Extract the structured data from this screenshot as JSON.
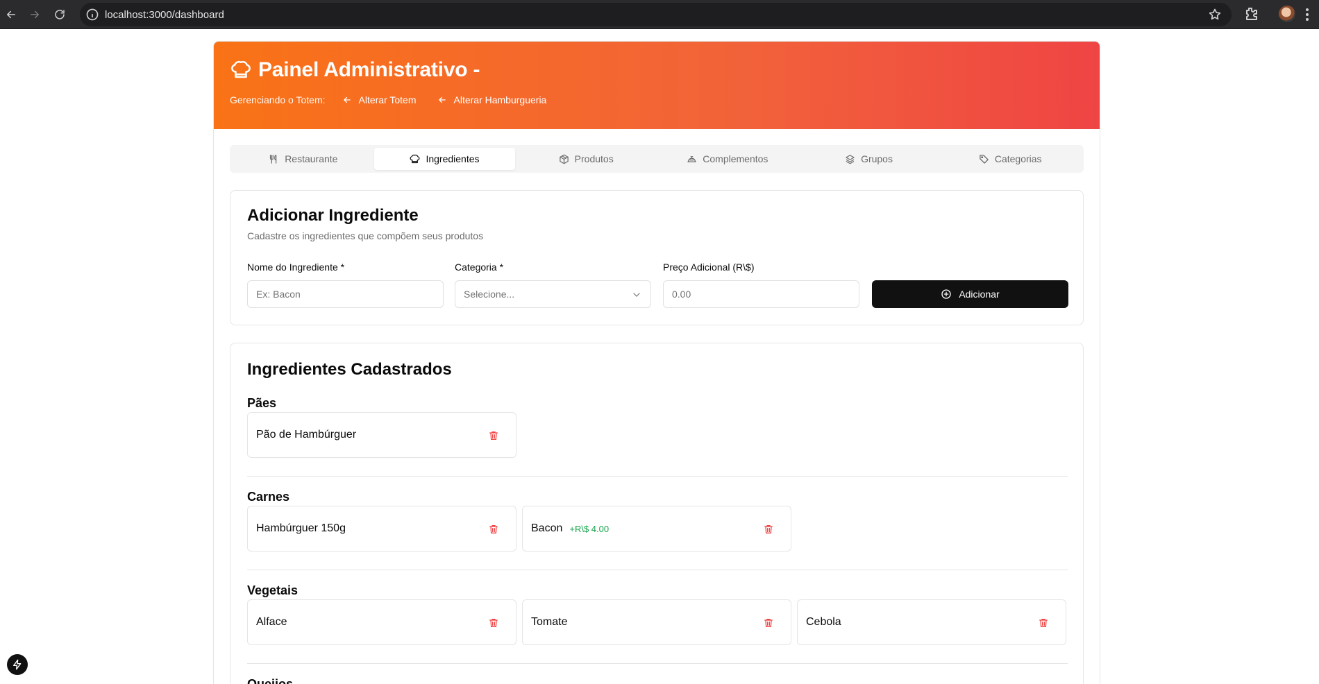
{
  "browser": {
    "url": "localhost:3000/dashboard",
    "icons": [
      "back-icon",
      "forward-icon",
      "reload-icon",
      "site-info-icon",
      "bookmark-star-icon",
      "extensions-icon",
      "profile-avatar",
      "menu-icon"
    ]
  },
  "header": {
    "title": "Painel Administrativo -",
    "subtitle_label": "Gerenciando o Totem:",
    "links": [
      "Alterar Totem",
      "Alterar Hamburgueria"
    ],
    "gradient": [
      "#f97316",
      "#ef4444"
    ]
  },
  "tabs": [
    {
      "label": "Restaurante",
      "icon": "utensils-icon",
      "active": false
    },
    {
      "label": "Ingredientes",
      "icon": "chef-hat-icon",
      "active": true
    },
    {
      "label": "Produtos",
      "icon": "package-icon",
      "active": false
    },
    {
      "label": "Complementos",
      "icon": "cloche-icon",
      "active": false
    },
    {
      "label": "Grupos",
      "icon": "layers-icon",
      "active": false
    },
    {
      "label": "Categorias",
      "icon": "tag-icon",
      "active": false
    }
  ],
  "add_form": {
    "title": "Adicionar Ingrediente",
    "description": "Cadastre os ingredientes que compõem seus produtos",
    "name_label": "Nome do Ingrediente *",
    "name_placeholder": "Ex: Bacon",
    "category_label": "Categoria *",
    "category_placeholder": "Selecione...",
    "price_label": "Preço Adicional (R\\$)",
    "price_placeholder": "0.00",
    "submit_label": "Adicionar"
  },
  "list": {
    "title": "Ingredientes Cadastrados",
    "sections": [
      {
        "name": "Pães",
        "items": [
          {
            "name": "Pão de Hambúrguer",
            "price": ""
          }
        ]
      },
      {
        "name": "Carnes",
        "items": [
          {
            "name": "Hambúrguer 150g",
            "price": ""
          },
          {
            "name": "Bacon",
            "price": "+R\\$ 4.00"
          }
        ]
      },
      {
        "name": "Vegetais",
        "items": [
          {
            "name": "Alface",
            "price": ""
          },
          {
            "name": "Tomate",
            "price": ""
          },
          {
            "name": "Cebola",
            "price": ""
          }
        ]
      },
      {
        "name": "Queijos",
        "items": []
      }
    ]
  },
  "colors": {
    "accent": "#f97316",
    "price_green": "#16a34a",
    "delete_red": "#ef4444",
    "button_dark": "#111111"
  }
}
